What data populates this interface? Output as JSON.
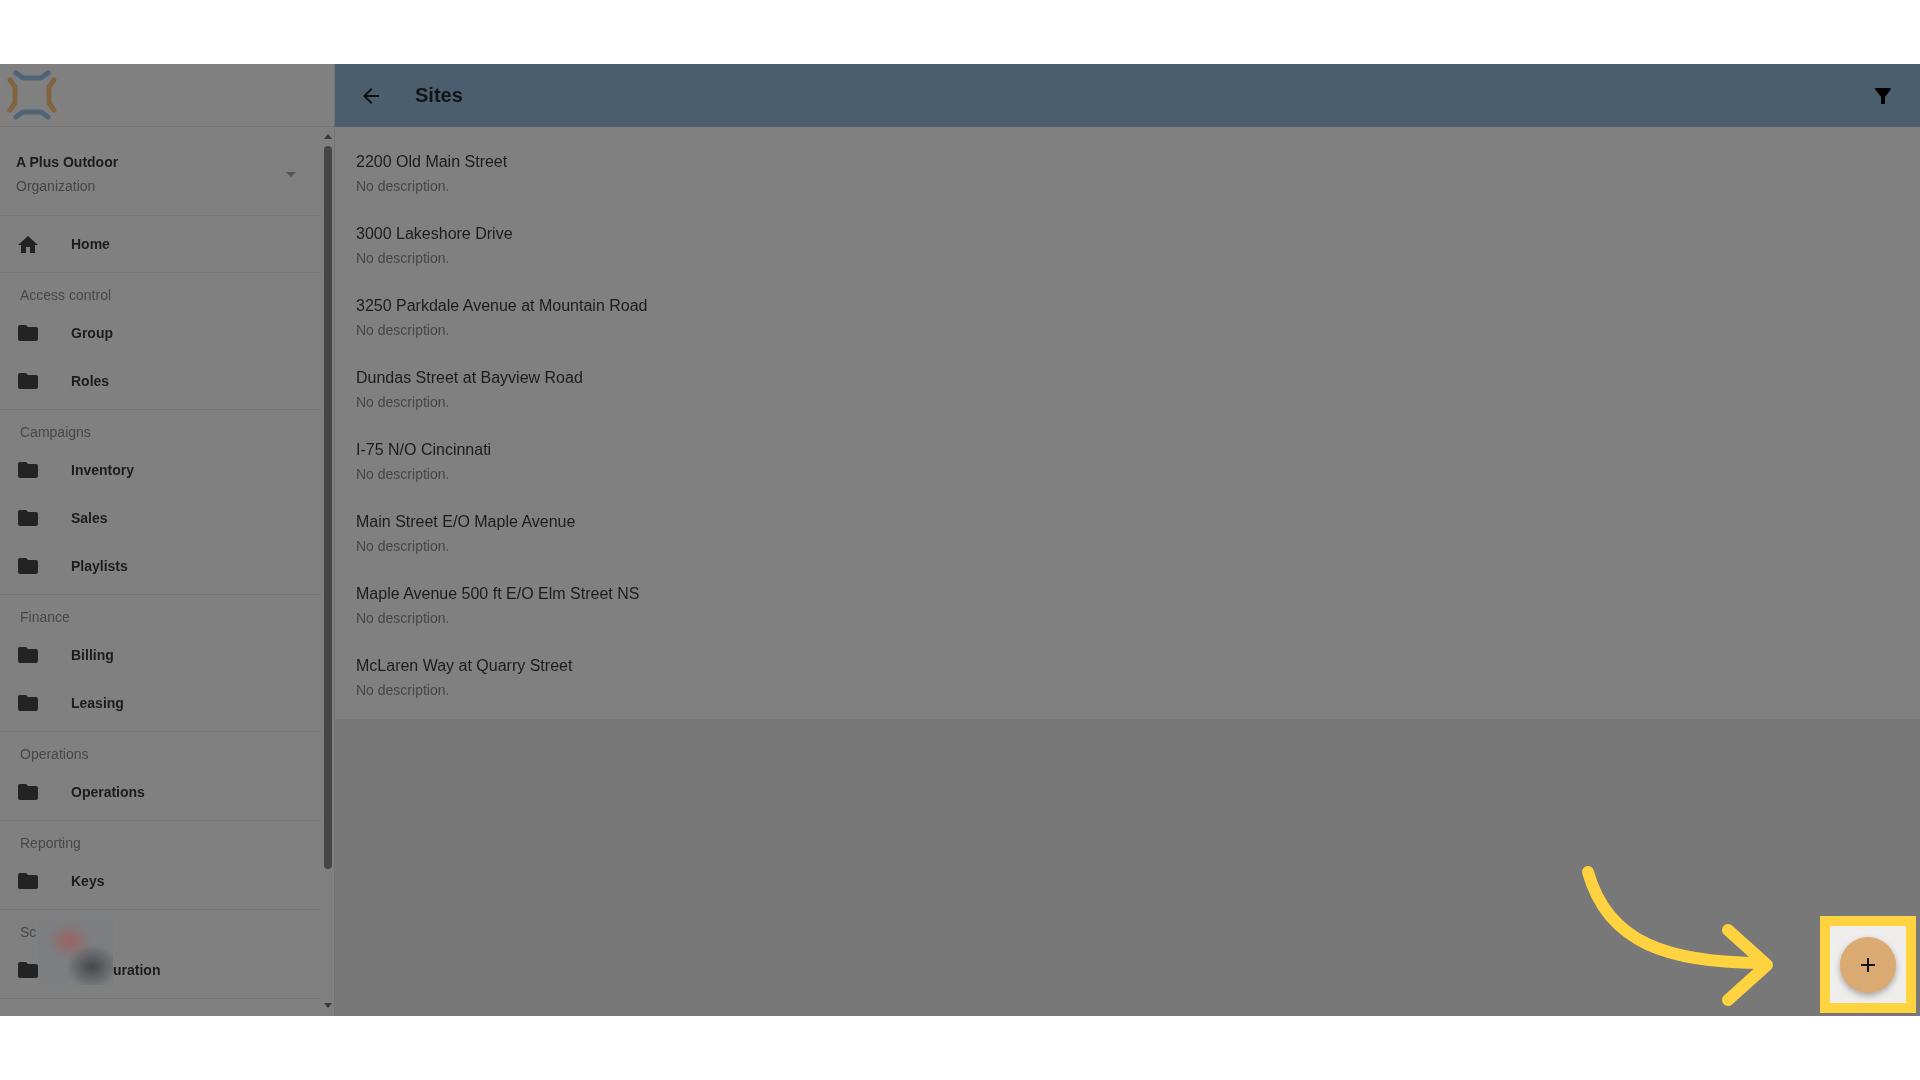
{
  "sidebar": {
    "organization": {
      "name": "A Plus Outdoor",
      "type": "Organization"
    },
    "home": {
      "label": "Home"
    },
    "sections": [
      {
        "heading": "Access control",
        "redacted": false,
        "items": [
          {
            "label": "Group"
          },
          {
            "label": "Roles"
          }
        ]
      },
      {
        "heading": "Campaigns",
        "redacted": false,
        "items": [
          {
            "label": "Inventory"
          },
          {
            "label": "Sales"
          },
          {
            "label": "Playlists"
          }
        ]
      },
      {
        "heading": "Finance",
        "redacted": false,
        "items": [
          {
            "label": "Billing"
          },
          {
            "label": "Leasing"
          }
        ]
      },
      {
        "heading": "Operations",
        "redacted": false,
        "items": [
          {
            "label": "Operations"
          }
        ]
      },
      {
        "heading": "Reporting",
        "redacted": false,
        "items": [
          {
            "label": "Keys"
          }
        ]
      },
      {
        "heading": "Sc",
        "redacted": true,
        "items": [
          {
            "label": "uration"
          }
        ]
      }
    ]
  },
  "header": {
    "title": "Sites"
  },
  "sites": [
    {
      "name": "2200 Old Main Street",
      "description": "No description."
    },
    {
      "name": "3000 Lakeshore Drive",
      "description": "No description."
    },
    {
      "name": "3250 Parkdale Avenue at Mountain Road",
      "description": "No description."
    },
    {
      "name": "Dundas Street at Bayview Road",
      "description": "No description."
    },
    {
      "name": "I-75 N/O Cincinnati",
      "description": "No description."
    },
    {
      "name": "Main Street E/O Maple Avenue",
      "description": "No description."
    },
    {
      "name": "Maple Avenue 500 ft E/O Elm Street NS",
      "description": "No description."
    },
    {
      "name": "McLaren Way at Quarry Street",
      "description": "No description."
    }
  ]
}
